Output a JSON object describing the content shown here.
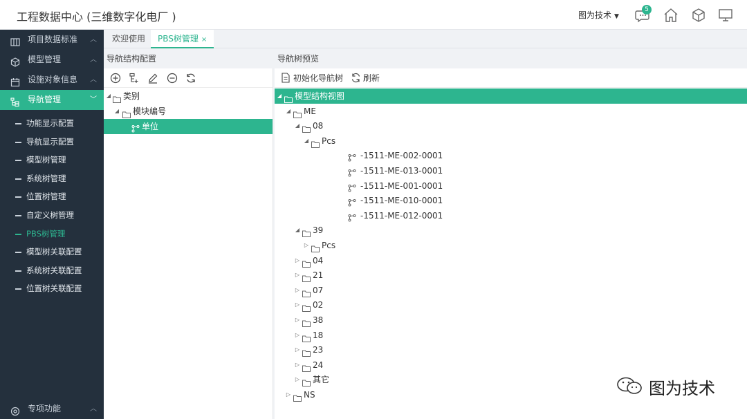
{
  "app": {
    "title": "工程数据中心 (三维数字化电厂 )"
  },
  "header": {
    "user": "图为技术",
    "chat_badge": "5"
  },
  "sidebar": {
    "items": [
      {
        "label": "项目数据标准",
        "icon": "columns-icon"
      },
      {
        "label": "模型管理",
        "icon": "cube-icon"
      },
      {
        "label": "设施对象信息",
        "icon": "calendar-icon"
      },
      {
        "label": "导航管理",
        "icon": "tree-icon"
      }
    ],
    "sub_items": [
      "功能显示配置",
      "导航显示配置",
      "模型树管理",
      "系统树管理",
      "位置树管理",
      "自定义树管理",
      "PBS树管理",
      "模型树关联配置",
      "系统树关联配置",
      "位置树关联配置"
    ],
    "bottom_item": "专项功能"
  },
  "tabs": [
    "欢迎使用",
    "PBS树管理"
  ],
  "left_panel": {
    "title": "导航结构配置",
    "tree": [
      "类别",
      "模块编号",
      "单位"
    ]
  },
  "right_panel": {
    "title": "导航树预览",
    "buttons": {
      "init": "初始化导航树",
      "refresh": "刷新"
    },
    "tree": [
      "模型结构视图",
      "ME",
      "08",
      "Pcs",
      "-1511-ME-002-0001",
      "-1511-ME-013-0001",
      "-1511-ME-001-0001",
      "-1511-ME-010-0001",
      "-1511-ME-012-0001",
      "39",
      "Pcs",
      "04",
      "21",
      "07",
      "02",
      "38",
      "18",
      "23",
      "24",
      "其它",
      "NS"
    ]
  },
  "watermark": "图为技术",
  "colors": {
    "accent": "#2db58f",
    "sidebar_bg": "#24303d"
  }
}
